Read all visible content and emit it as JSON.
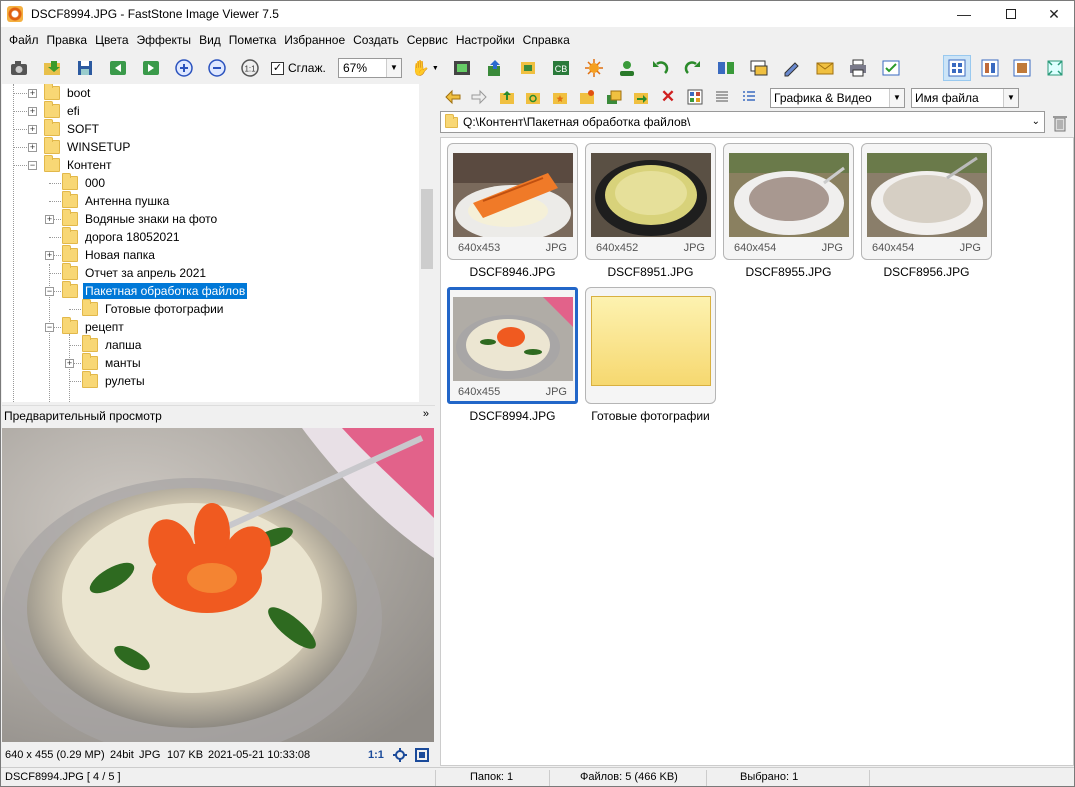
{
  "window": {
    "title": "DSCF8994.JPG  -  FastStone Image Viewer 7.5",
    "minimize_icon": "minimize-icon",
    "maximize_icon": "maximize-icon",
    "close_icon": "close-icon"
  },
  "menu": [
    "Файл",
    "Правка",
    "Цвета",
    "Эффекты",
    "Вид",
    "Пометка",
    "Избранное",
    "Создать",
    "Сервис",
    "Настройки",
    "Справка"
  ],
  "toolbar": {
    "smooth_label": "Сглаж.",
    "smooth_checked": true,
    "zoom_value": "67%"
  },
  "tree": {
    "items": [
      {
        "label": "boot",
        "expander": "+"
      },
      {
        "label": "efi",
        "expander": "+"
      },
      {
        "label": "SOFT",
        "expander": "+"
      },
      {
        "label": "WINSETUP",
        "expander": "+"
      },
      {
        "label": "Контент",
        "expander": "−"
      },
      {
        "label": "000",
        "expander": ""
      },
      {
        "label": "Антенна пушка",
        "expander": ""
      },
      {
        "label": "Водяные знаки на фото",
        "expander": "+"
      },
      {
        "label": "дорога 18052021",
        "expander": ""
      },
      {
        "label": "Новая папка",
        "expander": "+"
      },
      {
        "label": "Отчет за апрель 2021",
        "expander": ""
      },
      {
        "label": "Пакетная обработка файлов",
        "expander": "−",
        "selected": true
      },
      {
        "label": "Готовые фотографии",
        "expander": ""
      },
      {
        "label": "рецепт",
        "expander": "−"
      },
      {
        "label": "лапша",
        "expander": ""
      },
      {
        "label": "манты",
        "expander": "+"
      },
      {
        "label": "рулеты",
        "expander": ""
      }
    ]
  },
  "preview": {
    "header": "Предварительный просмотр",
    "status": {
      "dimensions": "640 x 455 (0.29 MP)",
      "bits": "24bit",
      "format": "JPG",
      "size": "107 KB",
      "datetime": "2021-05-21 10:33:08",
      "ratio": "1:1"
    }
  },
  "browser": {
    "filter": "Графика & Видео",
    "sort": "Имя файла",
    "path": "Q:\\Контент\\Пакетная обработка файлов\\",
    "thumbnails": [
      {
        "name": "DSCF8946.JPG",
        "dims": "640x453",
        "format": "JPG"
      },
      {
        "name": "DSCF8951.JPG",
        "dims": "640x452",
        "format": "JPG"
      },
      {
        "name": "DSCF8955.JPG",
        "dims": "640x454",
        "format": "JPG"
      },
      {
        "name": "DSCF8956.JPG",
        "dims": "640x454",
        "format": "JPG"
      },
      {
        "name": "DSCF8994.JPG",
        "dims": "640x455",
        "format": "JPG",
        "selected": true
      },
      {
        "name": "Готовые фотографии",
        "dims": "",
        "format": "",
        "folder": true
      }
    ]
  },
  "statusbar": {
    "file_index": "DSCF8994.JPG [ 4 / 5 ]",
    "folders": "Папок: 1",
    "files": "Файлов: 5 (466 KB)",
    "selected": "Выбрано: 1"
  },
  "colors": {
    "selection": "#0078d7",
    "thumb_selected_border": "#2266c8",
    "folder_yellow": "#f8d775"
  }
}
